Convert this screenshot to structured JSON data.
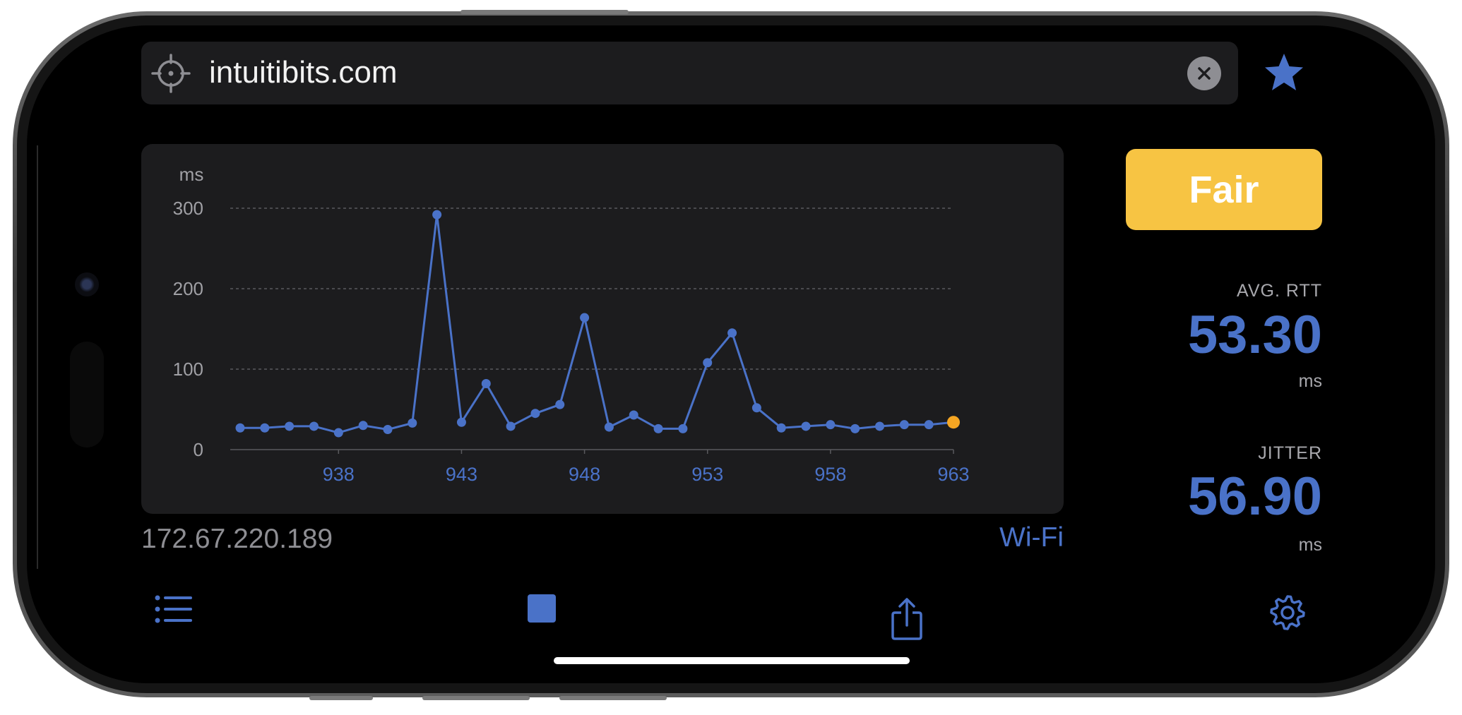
{
  "address_bar": {
    "url": "intuitibits.com"
  },
  "chart_data": {
    "type": "line",
    "ylabel": "ms",
    "ylim": [
      0,
      300
    ],
    "yticks": [
      0,
      100,
      200,
      300
    ],
    "xticks": [
      938,
      943,
      948,
      953,
      958,
      963
    ],
    "x": [
      934,
      935,
      936,
      937,
      938,
      939,
      940,
      941,
      942,
      943,
      944,
      945,
      946,
      947,
      948,
      949,
      950,
      951,
      952,
      953,
      954,
      955,
      956,
      957,
      958,
      959,
      960,
      961,
      962,
      963
    ],
    "values": [
      27,
      27,
      29,
      29,
      21,
      30,
      25,
      33,
      292,
      34,
      82,
      29,
      45,
      56,
      164,
      28,
      43,
      26,
      26,
      108,
      145,
      52,
      27,
      29,
      31,
      26,
      29,
      31,
      31,
      34
    ],
    "grid": true,
    "series_color": "#4a72c8",
    "last_point_color": "#f5a623"
  },
  "connection": {
    "ip": "172.67.220.189",
    "type": "Wi-Fi"
  },
  "quality": {
    "label": "Fair",
    "color": "#f7c443"
  },
  "stats": {
    "avg_rtt": {
      "label": "AVG. RTT",
      "value": "53.30",
      "unit": "ms"
    },
    "jitter": {
      "label": "JITTER",
      "value": "56.90",
      "unit": "ms"
    }
  },
  "toolbar": {
    "icons": [
      "list-icon",
      "stop-icon",
      "share-icon",
      "gear-icon"
    ]
  },
  "accent_color": "#4a72c8"
}
